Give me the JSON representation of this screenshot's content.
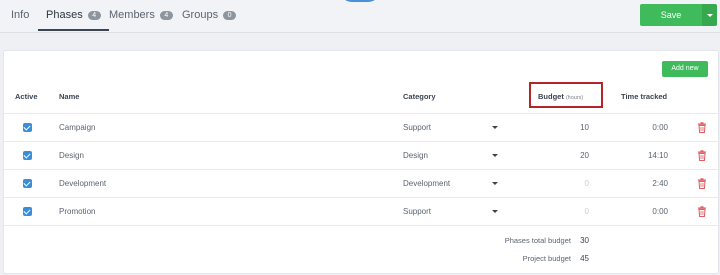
{
  "tabs": [
    {
      "label": "Info",
      "count": ""
    },
    {
      "label": "Phases",
      "count": "4"
    },
    {
      "label": "Members",
      "count": "4"
    },
    {
      "label": "Groups",
      "count": "0"
    }
  ],
  "toolbar": {
    "save_label": "Save"
  },
  "add_new_label": "Add new",
  "columns": {
    "active": "Active",
    "name": "Name",
    "category": "Category",
    "budget": "Budget",
    "budget_unit": "(hours)",
    "time_tracked": "Time tracked"
  },
  "phases": [
    {
      "active": true,
      "name": "Campaign",
      "category": "Support",
      "budget": "10",
      "time_tracked": "0:00",
      "budget_muted": false
    },
    {
      "active": true,
      "name": "Design",
      "category": "Design",
      "budget": "20",
      "time_tracked": "14:10",
      "budget_muted": false
    },
    {
      "active": true,
      "name": "Development",
      "category": "Development",
      "budget": "0",
      "time_tracked": "2:40",
      "budget_muted": true
    },
    {
      "active": true,
      "name": "Promotion",
      "category": "Support",
      "budget": "0",
      "time_tracked": "0:00",
      "budget_muted": true
    }
  ],
  "totals": {
    "phases_total_label": "Phases total budget",
    "phases_total_value": "30",
    "project_budget_label": "Project budget",
    "project_budget_value": "45"
  },
  "colors": {
    "accent_green": "#3fbb5b",
    "checkbox_blue": "#3b8ed6",
    "delete_red": "#e05a5f",
    "highlight_red": "#b1262b"
  },
  "icons": {
    "delete": "trash-icon",
    "select": "caret-down-icon",
    "check": "checkmark-icon"
  }
}
